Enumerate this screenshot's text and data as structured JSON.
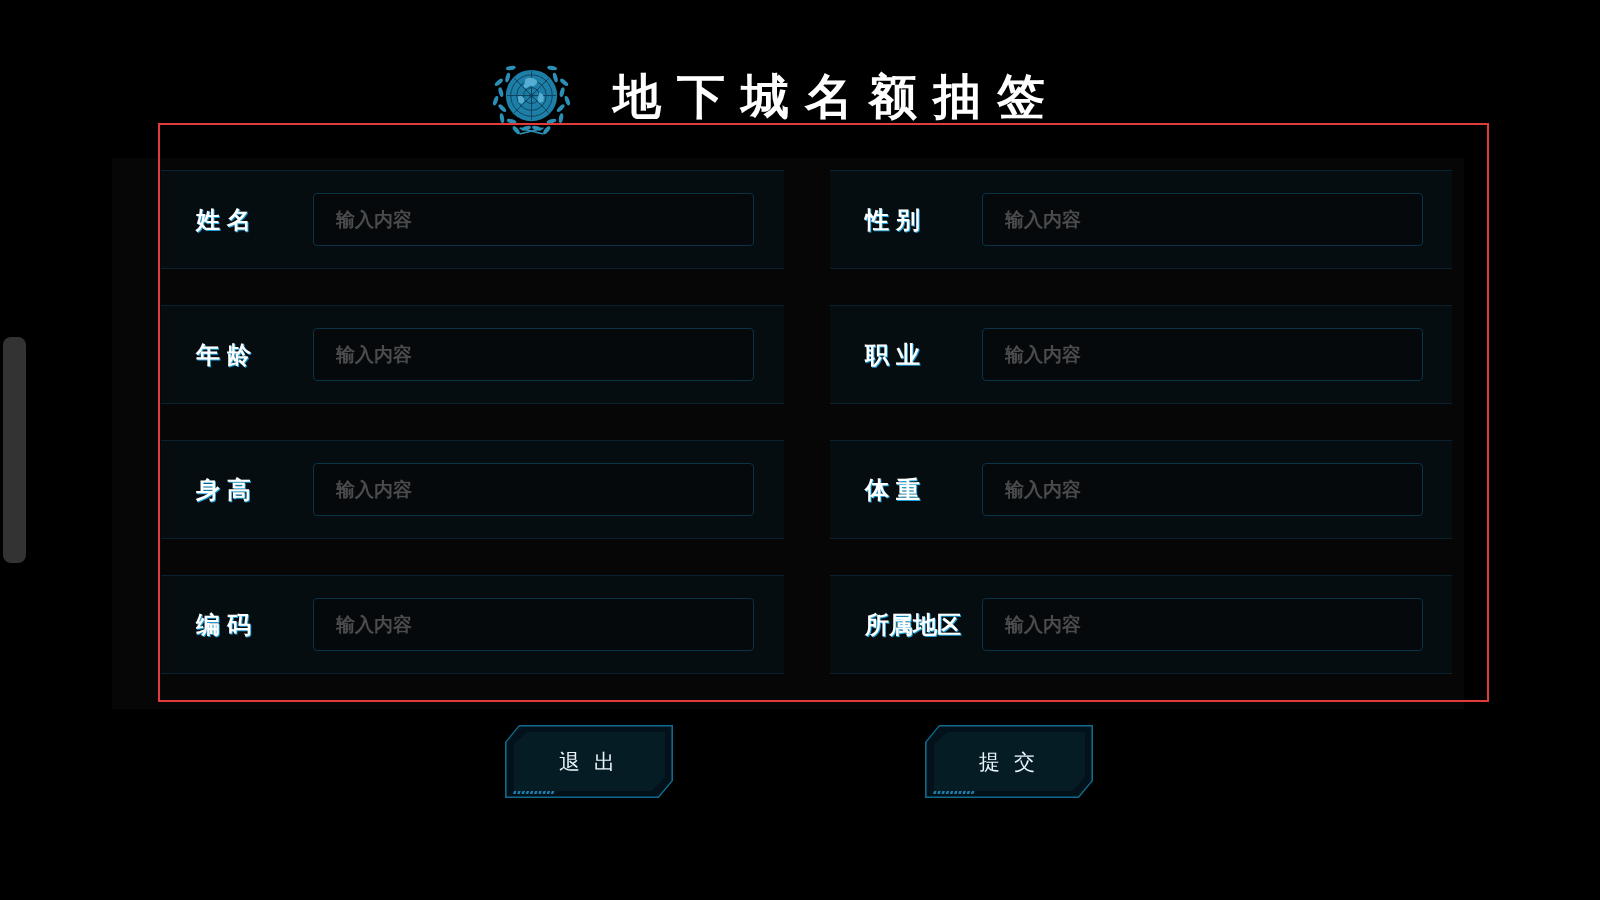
{
  "header": {
    "title": "地下城名额抽签"
  },
  "form": {
    "fields": [
      {
        "label": "姓 名",
        "placeholder": "输入内容"
      },
      {
        "label": "性 别",
        "placeholder": "输入内容"
      },
      {
        "label": "年 龄",
        "placeholder": "输入内容"
      },
      {
        "label": "职 业",
        "placeholder": "输入内容"
      },
      {
        "label": "身 高",
        "placeholder": "输入内容"
      },
      {
        "label": "体 重",
        "placeholder": "输入内容"
      },
      {
        "label": "编 码",
        "placeholder": "输入内容"
      },
      {
        "label": "所属地区",
        "placeholder": "输入内容"
      }
    ]
  },
  "buttons": [
    {
      "label": "退 出"
    },
    {
      "label": "提 交"
    }
  ]
}
